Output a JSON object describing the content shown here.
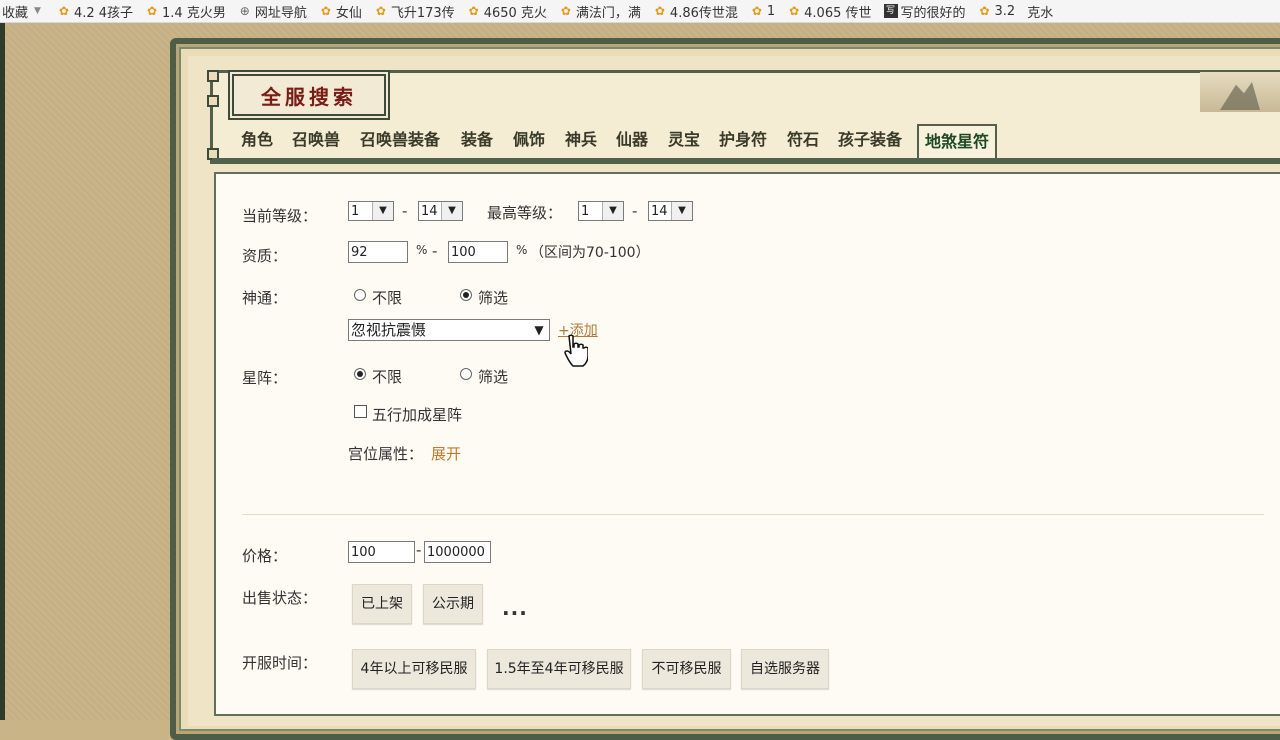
{
  "bookmarks": [
    {
      "label": "收藏",
      "icon": "star-folder-icon"
    },
    {
      "label": "4.2 4孩子",
      "icon": "weibo-star-icon"
    },
    {
      "label": "1.4 克火男",
      "icon": "weibo-star-icon"
    },
    {
      "label": "网址导航",
      "icon": "globe-icon"
    },
    {
      "label": "女仙",
      "icon": "weibo-star-icon"
    },
    {
      "label": "飞升173传",
      "icon": "weibo-star-icon"
    },
    {
      "label": "4650 克火",
      "icon": "weibo-star-icon"
    },
    {
      "label": "满法门，满",
      "icon": "weibo-star-icon"
    },
    {
      "label": "4.86传世混",
      "icon": "weibo-star-icon"
    },
    {
      "label": "1",
      "icon": "weibo-star-icon"
    },
    {
      "label": "4.065 传世",
      "icon": "weibo-star-icon"
    },
    {
      "label": "写的很好的",
      "icon": "page-icon"
    },
    {
      "label": "3.2",
      "icon": "weibo-star-icon"
    },
    {
      "label": "克水",
      "icon": "none"
    }
  ],
  "header": {
    "title": "全服搜索"
  },
  "tabs": [
    "角色",
    "召唤兽",
    "召唤兽装备",
    "装备",
    "佩饰",
    "神兵",
    "仙器",
    "灵宝",
    "护身符",
    "符石",
    "孩子装备",
    "地煞星符"
  ],
  "active_tab": "地煞星符",
  "form": {
    "current_level": {
      "label": "当前等级：",
      "from": "1",
      "to": "14",
      "dash": "-"
    },
    "max_level": {
      "label": "最高等级：",
      "from": "1",
      "to": "14",
      "dash": "-"
    },
    "quality": {
      "label": "资质：",
      "min": "92",
      "max": "100",
      "pct": "%",
      "dash": "-",
      "hint": "（区间为70-100）"
    },
    "shentong": {
      "label": "神通：",
      "option_unlimited": "不限",
      "option_filter": "筛选",
      "selected": "筛选",
      "dropdown_value": "忽视抗震慑",
      "add_link": "+添加"
    },
    "xingzhen": {
      "label": "星阵：",
      "option_unlimited": "不限",
      "option_filter": "筛选",
      "selected": "不限",
      "checkbox_label": "五行加成星阵",
      "checkbox_checked": false,
      "palace_label": "宫位属性：",
      "palace_link": "展开"
    },
    "price": {
      "label": "价格：",
      "min": "100",
      "max": "1000000",
      "dash": "-"
    },
    "sale_status": {
      "label": "出售状态：",
      "buttons": [
        "已上架",
        "公示期"
      ],
      "more": "..."
    },
    "server_time": {
      "label": "开服时间：",
      "buttons": [
        "4年以上可移民服",
        "1.5年至4年可移民服",
        "不可移民服",
        "自选服务器"
      ]
    }
  },
  "colors": {
    "accent_green": "#51614b",
    "title_red": "#7a1c16",
    "link_orange": "#c07a2c",
    "parchment": "#e9dcb7"
  }
}
